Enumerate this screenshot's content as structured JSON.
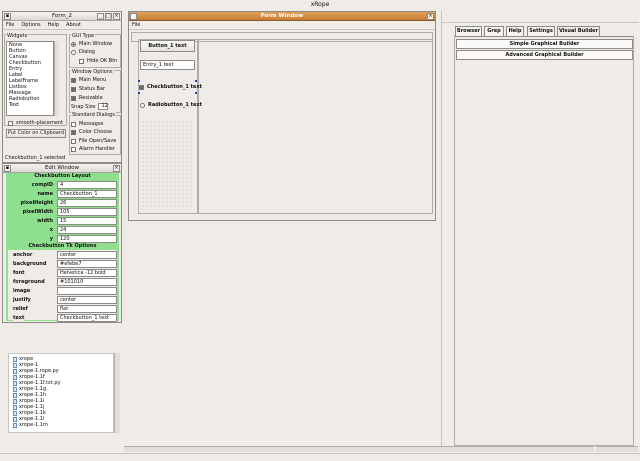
{
  "app": {
    "title": "xRope"
  },
  "form2": {
    "title": "Form_2",
    "menu": [
      "File",
      "Options",
      "Help",
      "About"
    ],
    "widgets_label": "Widgets",
    "widgets": [
      "None",
      "Button",
      "Canvas",
      "Checkbutton",
      "Entry",
      "Label",
      "LabelFrame",
      "Listbox",
      "Message",
      "Radiobutton",
      "Text"
    ],
    "gui_type_label": "GUI Type",
    "gui_type": [
      {
        "label": "Main Window",
        "selected": true
      },
      {
        "label": "Dialog",
        "selected": false
      }
    ],
    "hide_ok": "Hide OK Btn",
    "window_options_label": "Window Options",
    "window_options": [
      "Main Menu",
      "Status Bar",
      "Resizable"
    ],
    "snap_size_label": "Snap Size",
    "snap_size_value": "12",
    "standard_dialogs_label": "Standard Dialogs",
    "standard_dialogs": [
      "Messages",
      "Color Choose",
      "File Open/Save",
      "Alarm Handler"
    ],
    "smooth_placement": "smooth-placement",
    "put_color": "Put Color on Clipboard",
    "status": "Checkbutton_1 selected"
  },
  "edit_window": {
    "title": "Edit Window",
    "section1": "Checkbutton Layout",
    "layout_props": [
      {
        "name": "compID",
        "value": "4"
      },
      {
        "name": "name",
        "value": "Checkbutton_1"
      },
      {
        "name": "pixelHeight",
        "value": "26"
      },
      {
        "name": "pixelWidth",
        "value": "105"
      },
      {
        "name": "width",
        "value": "15"
      },
      {
        "name": "x",
        "value": "24"
      },
      {
        "name": "y",
        "value": "120"
      }
    ],
    "section2": "Checkbutton Tk Options",
    "tk_props": [
      {
        "name": "anchor",
        "value": "center"
      },
      {
        "name": "background",
        "value": "#efebe7"
      },
      {
        "name": "font",
        "value": "Helvetica -12 bold"
      },
      {
        "name": "foreground",
        "value": "#101010"
      },
      {
        "name": "image",
        "value": ""
      },
      {
        "name": "justify",
        "value": "center"
      },
      {
        "name": "relief",
        "value": "flat"
      },
      {
        "name": "text",
        "value": "Checkbutton_1 text"
      }
    ]
  },
  "file_tree": [
    "xrope",
    "xrope-1",
    "xrope-1.rope.py",
    "xrope-1.1f",
    "xrope-1.1f.txt.py",
    "xrope-1.1g",
    "xrope-1.1h",
    "xrope-1.1i",
    "xrope-1.1j",
    "xrope-1.1k",
    "xrope-1.1l",
    "xrope-1.1m"
  ],
  "form_window": {
    "title": "Form Window",
    "menu": [
      "File"
    ],
    "button_text": "Button_1 text",
    "entry_text": "Entry_1 text",
    "checkbutton_text": "Checkbutton_1 text",
    "radiobutton_text": "Radiobutton_1 text"
  },
  "right_panel": {
    "tabs": [
      "Browser",
      "Grep",
      "Help",
      "Settings",
      "Visual Builder"
    ],
    "active_tab": "Visual Builder",
    "buttons": [
      "Simple Graphical Builder",
      "Advanced Graphical Builder"
    ]
  },
  "colors": {
    "bg": "#efebe7",
    "green": "#8ee08e",
    "border": "#8e8a86"
  }
}
